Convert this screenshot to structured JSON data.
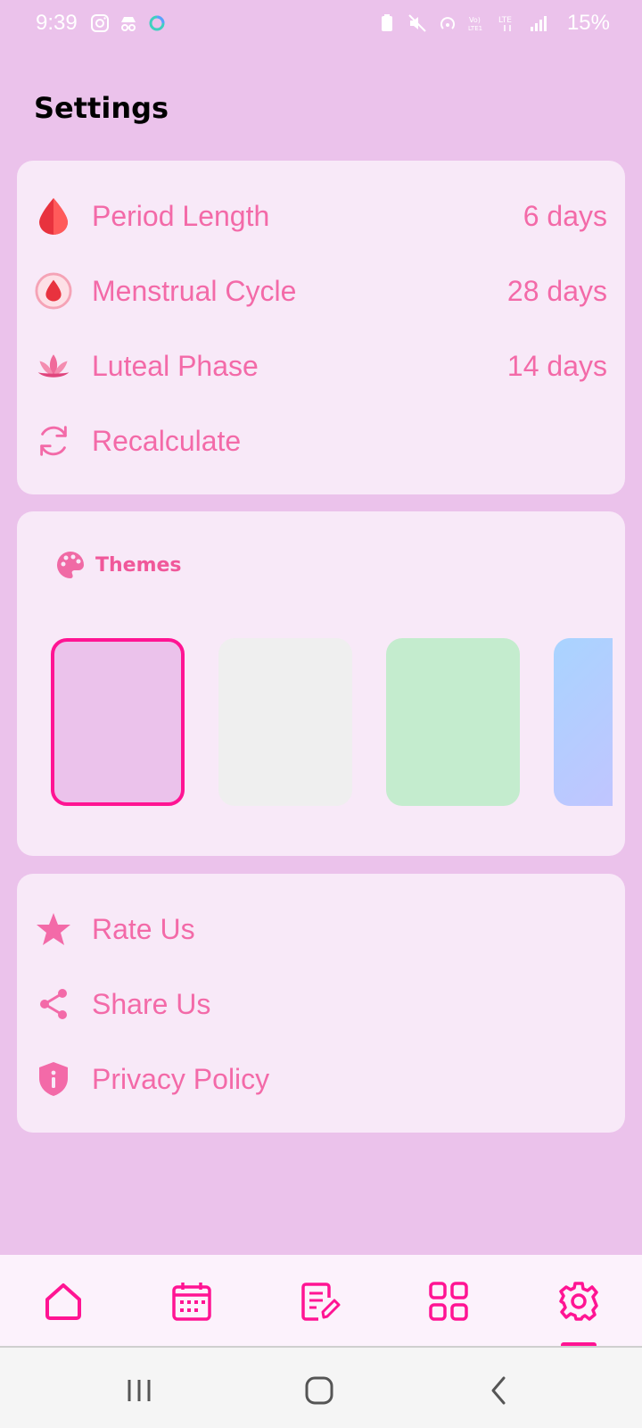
{
  "status": {
    "time": "9:39",
    "battery": "15%"
  },
  "page": {
    "title": "Settings"
  },
  "cycle_settings": [
    {
      "label": "Period Length",
      "value": "6 days",
      "icon": "blood-drop-icon"
    },
    {
      "label": "Menstrual Cycle",
      "value": "28 days",
      "icon": "drop-circle-icon"
    },
    {
      "label": "Luteal Phase",
      "value": "14 days",
      "icon": "lotus-icon"
    },
    {
      "label": "Recalculate",
      "value": "",
      "icon": "refresh-icon"
    }
  ],
  "themes": {
    "title": "Themes",
    "icon": "palette-icon",
    "swatches": [
      {
        "name": "pink",
        "color": "#ebc2eb",
        "selected": true
      },
      {
        "name": "light-gray",
        "color": "#efefef",
        "selected": false
      },
      {
        "name": "mint-green",
        "color": "#c4ecce",
        "selected": false
      },
      {
        "name": "blue-gradient",
        "color": "#b4c8ff",
        "selected": false
      }
    ]
  },
  "links": [
    {
      "label": "Rate Us",
      "icon": "star-icon"
    },
    {
      "label": "Share Us",
      "icon": "share-icon"
    },
    {
      "label": "Privacy Policy",
      "icon": "shield-info-icon"
    }
  ],
  "bottom_nav": {
    "items": [
      "home-icon",
      "calendar-icon",
      "notes-icon",
      "grid-icon",
      "settings-gear-icon"
    ],
    "active_index": 4
  },
  "colors": {
    "background": "#ebc2eb",
    "card": "#f8e9f8",
    "accent": "#f36aa8",
    "nav_accent": "#ff1493"
  }
}
